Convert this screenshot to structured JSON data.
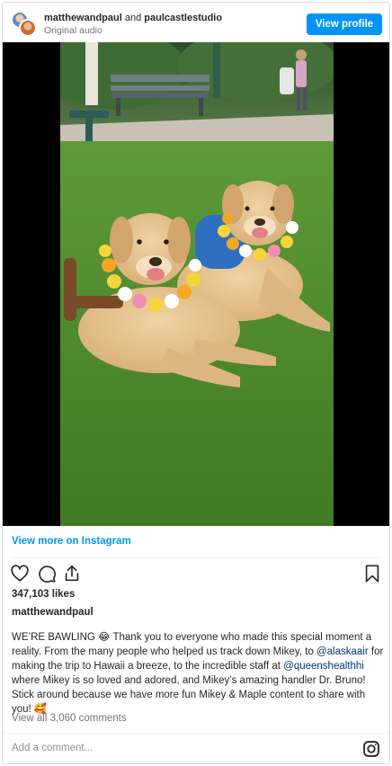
{
  "header": {
    "user1": "matthewandpaul",
    "connector": "and",
    "user2": "paulcastlestudio",
    "subtitle": "Original audio",
    "view_profile_label": "View profile"
  },
  "media": {
    "description_icon": "video-frame"
  },
  "view_more_label": "View more on Instagram",
  "actions": {
    "icons": [
      "heart-icon",
      "comment-icon",
      "share-icon",
      "bookmark-icon"
    ]
  },
  "likes": "347,103 likes",
  "caption": {
    "username": "matthewandpaul",
    "part1": "WE’RE BAWLING 😂 Thank you to everyone who made this special moment a reality. From the many people who helped us track down Mikey, to ",
    "mention1": "@alaskaair",
    "part2": " for making the trip to Hawaii a breeze, to the incredible staff at ",
    "mention2": "@queenshealthhi",
    "part3": " where Mikey is so loved and adored, and Mikey’s amazing handler Dr. Bruno! Stick around because we have more fun Mikey & Maple content to share with you! 🥰"
  },
  "comments_link": "View all 3,060 comments",
  "comment_input": {
    "placeholder": "Add a comment..."
  },
  "colors": {
    "accent": "#0095f6",
    "mention": "#00376b",
    "muted": "#737373"
  }
}
